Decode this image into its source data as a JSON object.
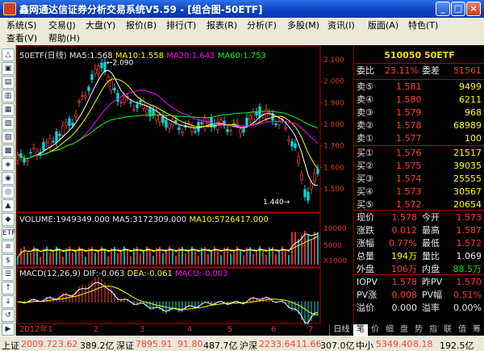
{
  "window": {
    "title": "鑫网通达信证券分析交易系统V5.59 - [组合图-50ETF]",
    "min_glyph": "_",
    "max_glyph": "□",
    "close_glyph": "×"
  },
  "menu": {
    "row1": [
      "系统(S)",
      "交易(J)",
      "大盘(Y)",
      "报价(B)",
      "排行(T)",
      "报表(R)",
      "分析(F)",
      "多股(M)",
      "资讯(I)",
      "版面(A)",
      "特色(T)"
    ],
    "row2": [
      "查看(V)",
      "帮助(H)"
    ]
  },
  "toolbar": [
    "△",
    "▣",
    "▤",
    "▥",
    "▦",
    "▧",
    "▨",
    "▩",
    "◈",
    "◉",
    "◎",
    "▲",
    "◆",
    "ETF",
    "≡",
    "$",
    "☰",
    "↑",
    "↓",
    "↺",
    "▶"
  ],
  "chart": {
    "main_legend": {
      "name": "50ETF(日线)",
      "ma5": "MA5:1.568",
      "ma10": "MA10:1.558",
      "ma20": "MA20:1.643",
      "ma60": "MA60:1.753"
    },
    "high_label": "2.090",
    "low_label": "1.440",
    "price_axis": [
      "2.100",
      "2.000",
      "1.900",
      "1.800",
      "1.700",
      "1.600",
      "1.500"
    ],
    "volume_legend": {
      "volume": "VOLUME:1949349.000",
      "ma5": "MA5:3172309.000",
      "ma10": "MA10:5726417.000"
    },
    "volume_axis": [
      "10000",
      "5000",
      "X1000"
    ],
    "macd_legend": {
      "name": "MACD(12,26,9)",
      "dif": "DIF:-0.063",
      "dea": "DEA:-0.061",
      "macd": "MACD:-0.003"
    },
    "date_ticks": [
      "2012年1",
      "2",
      "3",
      "4",
      "5",
      "6",
      "7"
    ],
    "daily_tab": "日线",
    "colors": {
      "ma5": "#ffffff",
      "ma10": "#ffff00",
      "ma20": "#ff00ff",
      "ma60": "#00ff00",
      "up": "#ff3b3b",
      "down": "#00dcdc"
    }
  },
  "quote": {
    "header": "510050 50ETF",
    "wei_bi_label": "委比",
    "wei_bi": "23.11%",
    "wei_cha_label": "委差",
    "wei_cha": "51561",
    "sell": [
      {
        "label": "卖⑤",
        "price": "1.581",
        "vol": "9499"
      },
      {
        "label": "卖④",
        "price": "1.580",
        "vol": "6211"
      },
      {
        "label": "卖③",
        "price": "1.579",
        "vol": "968"
      },
      {
        "label": "卖②",
        "price": "1.578",
        "vol": "68989"
      },
      {
        "label": "卖①",
        "price": "1.577",
        "vol": "100"
      }
    ],
    "buy": [
      {
        "label": "买①",
        "price": "1.576",
        "vol": "21517"
      },
      {
        "label": "买②",
        "price": "1.575",
        "vol": "39035"
      },
      {
        "label": "买③",
        "price": "1.574",
        "vol": "25555"
      },
      {
        "label": "买④",
        "price": "1.573",
        "vol": "30567"
      },
      {
        "label": "买⑤",
        "price": "1.572",
        "vol": "20654"
      }
    ],
    "stats": [
      {
        "l1": "现价",
        "v1": "1.578",
        "l2": "今开",
        "v2": "1.573"
      },
      {
        "l1": "涨跌",
        "v1": "0.012",
        "l2": "最高",
        "v2": "1.587"
      },
      {
        "l1": "涨幅",
        "v1": "0.77%",
        "l2": "最低",
        "v2": "1.572"
      },
      {
        "l1": "总量",
        "v1": "194万",
        "l2": "量比",
        "v2": "1.069"
      },
      {
        "l1": "外盘",
        "v1": "106万",
        "l2": "内盘",
        "v2": "88.5万"
      }
    ],
    "iopv": [
      {
        "l1": "IOPV",
        "v1": "1.578",
        "l2": "昨PV",
        "v2": "1.570"
      },
      {
        "l1": "PV涨",
        "v1": "0.008",
        "l2": "PV幅",
        "v2": "0.51%"
      },
      {
        "l1": "溢价",
        "v1": "0.000",
        "l2": "溢率",
        "v2": "0.00%"
      }
    ],
    "tabs": [
      "笔",
      "价",
      "细",
      "盘",
      "势",
      "指",
      "联",
      "值",
      "筹"
    ]
  },
  "status": {
    "sh_label": "上证",
    "sh_index": "2009.72",
    "sh_change": "3.62",
    "sh_amount": "389.2亿",
    "sz_label": "深证",
    "sz_index": "7895.91",
    "sz_change": "91.80",
    "sz_amount": "487.7亿",
    "hs_label": "沪深",
    "hs_index": "2233.64",
    "hs_change": "11.66",
    "hs_amount": "307.0亿",
    "zx_label": "中小",
    "zx_index": "5349.40",
    "zx_change": "8.18",
    "zx_amount": "192.5亿"
  }
}
